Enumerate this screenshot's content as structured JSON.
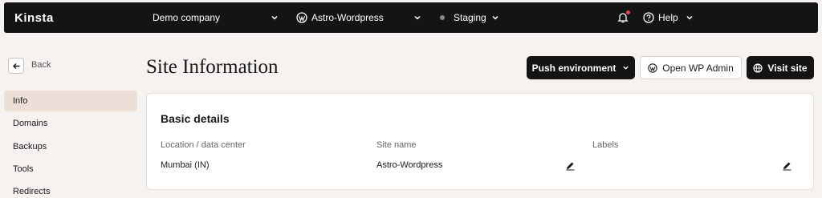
{
  "topbar": {
    "logo": "Kinsta",
    "company": "Demo company",
    "site": "Astro-Wordpress",
    "environment": "Staging",
    "help": "Help"
  },
  "sidebar": {
    "back_label": "Back",
    "items": [
      {
        "label": "Info",
        "active": true
      },
      {
        "label": "Domains"
      },
      {
        "label": "Backups"
      },
      {
        "label": "Tools"
      },
      {
        "label": "Redirects"
      }
    ]
  },
  "header": {
    "title": "Site Information",
    "push_label": "Push environment",
    "wp_admin_label": "Open WP Admin",
    "visit_label": "Visit site"
  },
  "basic_details": {
    "title": "Basic details",
    "location_label": "Location / data center",
    "location_value": "Mumbai (IN)",
    "site_name_label": "Site name",
    "site_name_value": "Astro-Wordpress",
    "labels_label": "Labels"
  },
  "colors": {
    "background": "#f6f2ef",
    "topbar": "#141414",
    "active_item": "#ebdfd7",
    "notification_dot": "#e5484d"
  }
}
